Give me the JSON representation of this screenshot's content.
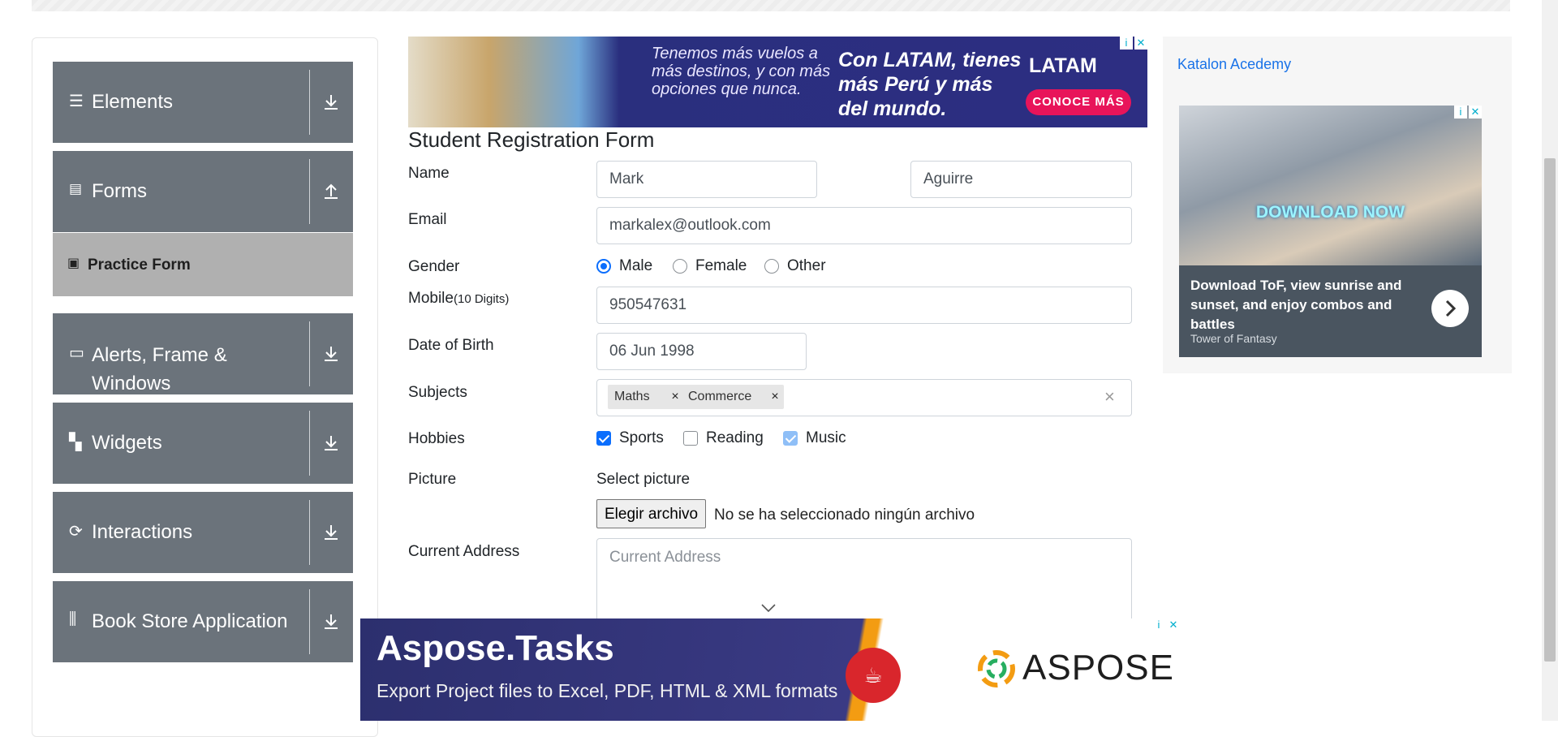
{
  "sidebar": {
    "groups": [
      {
        "label": "Elements",
        "icon": "hamburger-icon",
        "arrow": "download-icon"
      },
      {
        "label": "Forms",
        "icon": "document-icon",
        "arrow": "upload-icon"
      },
      {
        "label": "Alerts, Frame & Windows",
        "icon": "window-icon",
        "arrow": "download-icon"
      },
      {
        "label": "Widgets",
        "icon": "widgets-icon",
        "arrow": "download-icon"
      },
      {
        "label": "Interactions",
        "icon": "refresh-icon",
        "arrow": "download-icon"
      },
      {
        "label": "Book Store Application",
        "icon": "books-icon",
        "arrow": "download-icon"
      }
    ],
    "forms_subitem": {
      "label": "Practice Form",
      "icon": "html5-icon"
    }
  },
  "form": {
    "title": "Student Registration Form",
    "name_label": "Name",
    "first_name": "Mark",
    "last_name": "Aguirre",
    "email_label": "Email",
    "email": "markalex@outlook.com",
    "gender_label": "Gender",
    "gender_options": [
      "Male",
      "Female",
      "Other"
    ],
    "gender_selected": "Male",
    "mobile_label": "Mobile",
    "mobile_hint": "(10 Digits)",
    "mobile": "950547631",
    "dob_label": "Date of Birth",
    "dob": "06 Jun 1998",
    "subjects_label": "Subjects",
    "subjects": [
      "Maths",
      "Commerce"
    ],
    "subjects_clear": "×",
    "hobbies_label": "Hobbies",
    "hobbies": [
      {
        "label": "Sports",
        "checked": true
      },
      {
        "label": "Reading",
        "checked": false
      },
      {
        "label": "Music",
        "checked": true
      }
    ],
    "picture_label": "Picture",
    "select_picture": "Select picture",
    "file_button": "Elegir archivo",
    "file_status": "No se ha seleccionado ningún archivo",
    "address_label": "Current Address",
    "address_placeholder": "Current Address"
  },
  "ads": {
    "top": {
      "tagline": "Tenemos más vuelos a más destinos, y con más opciones que nunca.",
      "headline": "Con LATAM, tienes más Perú y más del mundo.",
      "brand": "LATAM",
      "cta": "CONOCE MÁS"
    },
    "right": {
      "broken_link": "Katalon Acedemy",
      "banner": "DOWNLOAD NOW",
      "caption": "Download ToF, view sunrise and sunset, and enjoy combos and battles",
      "source": "Tower of Fantasy"
    },
    "bottom": {
      "headline": "Aspose.Tasks",
      "subline": "Export Project files to Excel, PDF, HTML & XML formats",
      "brand": "ASPOSE"
    },
    "info_glyph": "i",
    "close_glyph": "✕"
  },
  "colors": {
    "sidebar_group_bg": "#6b737b",
    "sidebar_subitem_bg": "#b0b0b0",
    "primary": "#0b6efd"
  }
}
